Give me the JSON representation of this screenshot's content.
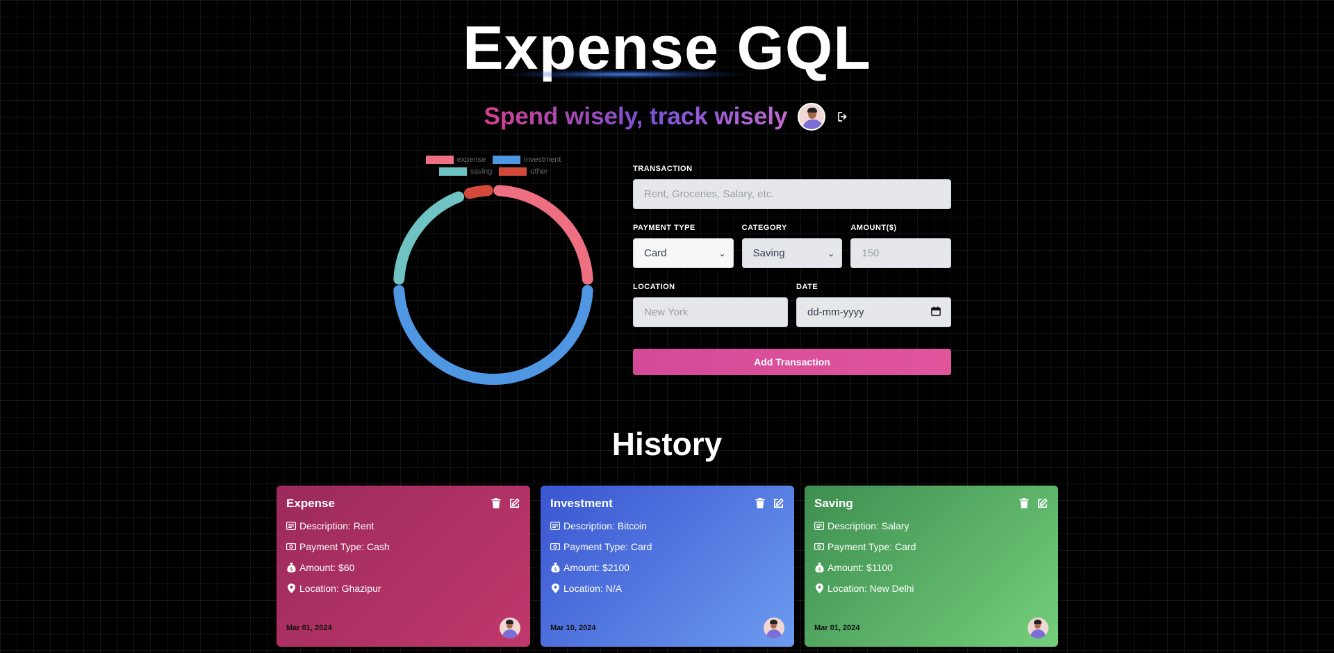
{
  "header": {
    "title": "Expense GQL",
    "subtitle": "Spend wisely, track wisely"
  },
  "chart_data": {
    "type": "pie",
    "categories": [
      "expense",
      "investment",
      "saving",
      "other"
    ],
    "values": [
      25,
      50,
      20,
      5
    ],
    "colors": [
      "#ef6f82",
      "#4f97e3",
      "#6fc4c3",
      "#d3493a"
    ],
    "legend": "top",
    "style": "doughnut"
  },
  "form": {
    "transaction_label": "TRANSACTION",
    "transaction_placeholder": "Rent, Groceries, Salary, etc.",
    "payment_type_label": "PAYMENT TYPE",
    "payment_type_value": "Card",
    "category_label": "CATEGORY",
    "category_value": "Saving",
    "amount_label": "AMOUNT($)",
    "amount_placeholder": "150",
    "location_label": "LOCATION",
    "location_placeholder": "New York",
    "date_label": "DATE",
    "date_placeholder": "dd-mm-yyyy",
    "submit_label": "Add Transaction"
  },
  "history": {
    "title": "History",
    "cards": [
      {
        "category": "Expense",
        "description": "Description: Rent",
        "payment_type": "Payment Type: Cash",
        "amount": "Amount: $60",
        "location": "Location: Ghazipur",
        "date": "Mar 01, 2024"
      },
      {
        "category": "Investment",
        "description": "Description: Bitcoin",
        "payment_type": "Payment Type: Card",
        "amount": "Amount: $2100",
        "location": "Location: N/A",
        "date": "Mar 10, 2024"
      },
      {
        "category": "Saving",
        "description": "Description: Salary",
        "payment_type": "Payment Type: Card",
        "amount": "Amount: $1100",
        "location": "Location: New Delhi",
        "date": "Mar 01, 2024"
      }
    ]
  }
}
